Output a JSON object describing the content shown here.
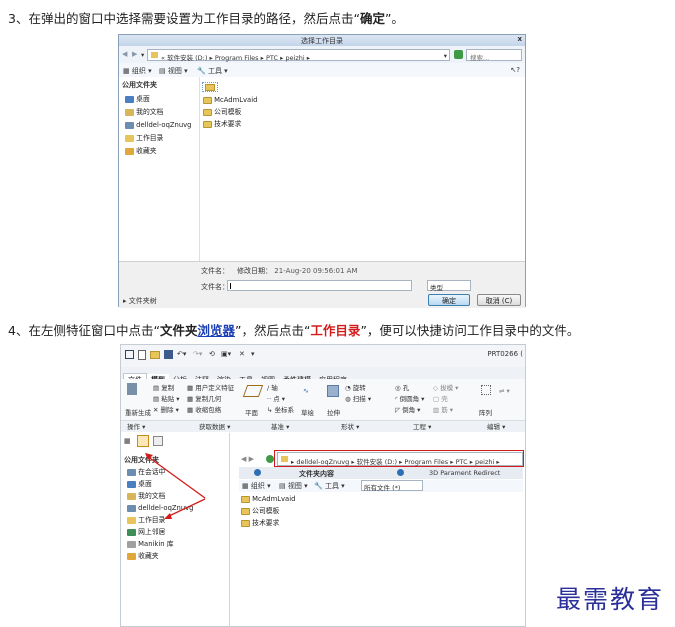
{
  "step3": {
    "prefix": "3、在弹出的窗口中选择需要设置为工作目录的路径，然后点击“",
    "bold": "确定",
    "suffix": "”。"
  },
  "step4": {
    "prefix": "4、在左侧特征窗口中点击“",
    "bold1": "文件夹",
    "link": "浏览器",
    "mid": "”，然后点击“",
    "red": "工作目录",
    "suffix": "”，便可以快捷访问工作目录中的文件。"
  },
  "dialog": {
    "title": "选择工作目录",
    "close": "x",
    "path": [
      "«",
      "软件安装 (D:)",
      "Program Files",
      "PTC",
      "peizhi"
    ],
    "search_placeholder": "搜索...",
    "toolbar": {
      "organize": "组织",
      "view": "视图",
      "tools": "工具"
    },
    "help": "?",
    "sidebar_header": "公用文件夹",
    "sidebar_items": [
      "桌面",
      "我的文档",
      "delldel-oqZnuvg",
      "工作目录",
      "收藏夹"
    ],
    "folders": [
      "..",
      "McAdmLvaid",
      "公司模板",
      "技术要求"
    ],
    "footer": {
      "name_label": "文件名：",
      "date_label": "修改日期：",
      "date_value": "21-Aug-20 09:56:01 AM",
      "filename_label": "文件名：",
      "type_value": "类型",
      "ok": "确定",
      "cancel": "取消 (C)",
      "tree": "文件夹树"
    }
  },
  "creo": {
    "title": "PRT0266 (",
    "tabs": [
      "文件",
      "模型",
      "分析",
      "注释",
      "渲染",
      "工具",
      "视图",
      "柔性建模",
      "应用程序"
    ],
    "active_tab": "模型",
    "ribbon": {
      "g1": [
        "复制",
        "粘贴",
        "删除"
      ],
      "g1b": [
        "用户定义特征",
        "复制几何",
        "收缩包络"
      ],
      "g2": [
        "轴",
        "点",
        "坐标系"
      ],
      "g2b": [
        "平面",
        "草绘"
      ],
      "g3": [
        "拉伸",
        "旋转",
        "扫描"
      ],
      "g4": [
        "孔",
        "倒圆角",
        "倒角",
        "拔模",
        "壳",
        "筋"
      ],
      "g5": [
        "阵列",
        "镜像"
      ],
      "g1c": "重新生成"
    },
    "groups": [
      "操作",
      "获取数据",
      "基准",
      "形状",
      "工程",
      "编辑"
    ],
    "nav_header": "公用文件夹",
    "nav_items": [
      "在会话中",
      "桌面",
      "我的文档",
      "delldel-oqZnuvg",
      "工作目录",
      "网上邻居",
      "Manikin 库",
      "收藏夹"
    ],
    "path": [
      "delldel-oqZnuvg",
      "软件安装 (D:)",
      "Program Files",
      "PTC",
      "peizhi"
    ],
    "browser_tab1": "文件夹内容",
    "browser_tab2": "3D Parament Redirect",
    "toolbar": {
      "organize": "组织",
      "view": "视图",
      "tools": "工具",
      "filter": "所有文件 (*)"
    },
    "folders": [
      "McAdmLvaid",
      "公司模板",
      "技术要求"
    ]
  },
  "watermark": "最需教育",
  "colors": {
    "red": "#d31b1b",
    "link": "#1a3fb5",
    "watermark": "#2a2f9a"
  }
}
